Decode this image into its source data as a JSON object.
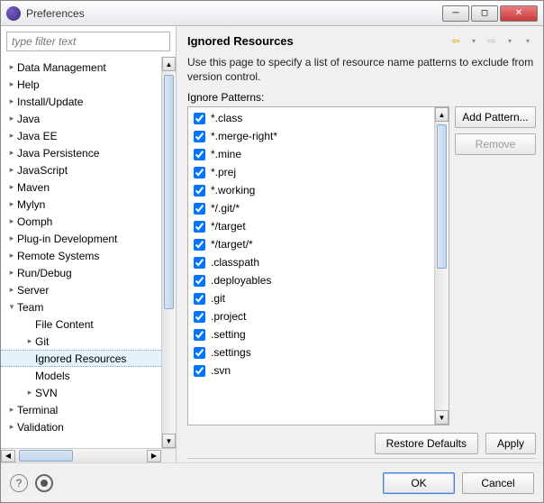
{
  "window": {
    "title": "Preferences"
  },
  "filter": {
    "placeholder": "type filter text"
  },
  "tree": [
    {
      "label": "Data Management",
      "lvl": 0,
      "arr": "col"
    },
    {
      "label": "Help",
      "lvl": 0,
      "arr": "col"
    },
    {
      "label": "Install/Update",
      "lvl": 0,
      "arr": "col"
    },
    {
      "label": "Java",
      "lvl": 0,
      "arr": "col"
    },
    {
      "label": "Java EE",
      "lvl": 0,
      "arr": "col"
    },
    {
      "label": "Java Persistence",
      "lvl": 0,
      "arr": "col"
    },
    {
      "label": "JavaScript",
      "lvl": 0,
      "arr": "col"
    },
    {
      "label": "Maven",
      "lvl": 0,
      "arr": "col"
    },
    {
      "label": "Mylyn",
      "lvl": 0,
      "arr": "col"
    },
    {
      "label": "Oomph",
      "lvl": 0,
      "arr": "col"
    },
    {
      "label": "Plug-in Development",
      "lvl": 0,
      "arr": "col"
    },
    {
      "label": "Remote Systems",
      "lvl": 0,
      "arr": "col"
    },
    {
      "label": "Run/Debug",
      "lvl": 0,
      "arr": "col"
    },
    {
      "label": "Server",
      "lvl": 0,
      "arr": "col"
    },
    {
      "label": "Team",
      "lvl": 0,
      "arr": "exp"
    },
    {
      "label": "File Content",
      "lvl": 1,
      "arr": "none"
    },
    {
      "label": "Git",
      "lvl": 1,
      "arr": "col"
    },
    {
      "label": "Ignored Resources",
      "lvl": 1,
      "arr": "none",
      "selected": true
    },
    {
      "label": "Models",
      "lvl": 1,
      "arr": "none"
    },
    {
      "label": "SVN",
      "lvl": 1,
      "arr": "col"
    },
    {
      "label": "Terminal",
      "lvl": 0,
      "arr": "col"
    },
    {
      "label": "Validation",
      "lvl": 0,
      "arr": "col"
    }
  ],
  "panel": {
    "title": "Ignored Resources",
    "desc": "Use this page to specify a list of resource name patterns to exclude from version control.",
    "list_label": "Ignore Patterns:",
    "add_label": "Add Pattern...",
    "remove_label": "Remove",
    "restore_label": "Restore Defaults",
    "apply_label": "Apply"
  },
  "patterns": [
    {
      "checked": true,
      "text": "*.class"
    },
    {
      "checked": true,
      "text": "*.merge-right*"
    },
    {
      "checked": true,
      "text": "*.mine"
    },
    {
      "checked": true,
      "text": "*.prej"
    },
    {
      "checked": true,
      "text": "*.working"
    },
    {
      "checked": true,
      "text": "*/.git/*"
    },
    {
      "checked": true,
      "text": "*/target"
    },
    {
      "checked": true,
      "text": "*/target/*"
    },
    {
      "checked": true,
      "text": ".classpath"
    },
    {
      "checked": true,
      "text": ".deployables"
    },
    {
      "checked": true,
      "text": ".git"
    },
    {
      "checked": true,
      "text": ".project"
    },
    {
      "checked": true,
      "text": ".setting"
    },
    {
      "checked": true,
      "text": ".settings"
    },
    {
      "checked": true,
      "text": ".svn"
    }
  ],
  "footer": {
    "ok": "OK",
    "cancel": "Cancel"
  }
}
